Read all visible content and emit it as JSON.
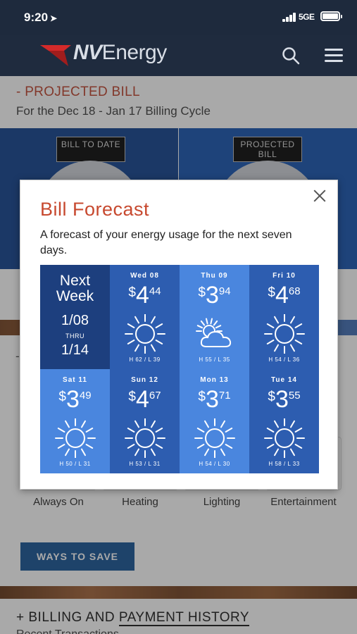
{
  "status_bar": {
    "time": "9:20",
    "network": "5GE"
  },
  "header": {
    "logo_prefix": "NV",
    "logo_suffix": "Energy",
    "logo_color": "#d42a2a"
  },
  "page": {
    "section_title": "- PROJECTED BILL",
    "billing_cycle": "For the Dec 18 - Jan 17 Billing Cycle",
    "tooltip_left": "BILL TO DATE",
    "tooltip_right": "PROJECTED BILL",
    "categories": [
      "Always On",
      "Heating",
      "Lighting",
      "Entertainment"
    ],
    "ways_to_save": "WAYS TO SAVE",
    "history_prefix": "+ BILLING AND ",
    "history_underlined": "PAYMENT HISTORY",
    "history_next": "Recent Transactions"
  },
  "modal": {
    "title": "Bill Forecast",
    "description": "A forecast of your energy usage for the next seven days.",
    "next_week": {
      "label": "Next Week",
      "from": "1/08",
      "thru": "THRU",
      "to": "1/14"
    },
    "forecast": [
      {
        "day": "Wed 08",
        "dollars": "4",
        "cents": "44",
        "weather": "sunny",
        "hl": "H 62 / L 39"
      },
      {
        "day": "Thu 09",
        "dollars": "3",
        "cents": "94",
        "weather": "partly-cloudy",
        "hl": "H 55 / L 35"
      },
      {
        "day": "Fri 10",
        "dollars": "4",
        "cents": "68",
        "weather": "sunny",
        "hl": "H 54 / L 36"
      },
      {
        "day": "Sat 11",
        "dollars": "3",
        "cents": "49",
        "weather": "sunny",
        "hl": "H 50 / L 31"
      },
      {
        "day": "Sun 12",
        "dollars": "4",
        "cents": "67",
        "weather": "sunny",
        "hl": "H 53 / L 31"
      },
      {
        "day": "Mon 13",
        "dollars": "3",
        "cents": "71",
        "weather": "sunny",
        "hl": "H 54 / L 30"
      },
      {
        "day": "Tue 14",
        "dollars": "3",
        "cents": "55",
        "weather": "sunny",
        "hl": "H 58 / L 33"
      }
    ],
    "colors": {
      "navy": "#1d3f7e",
      "mid": "#2d5db0",
      "light": "#4a86de",
      "title": "#c7492f"
    }
  }
}
